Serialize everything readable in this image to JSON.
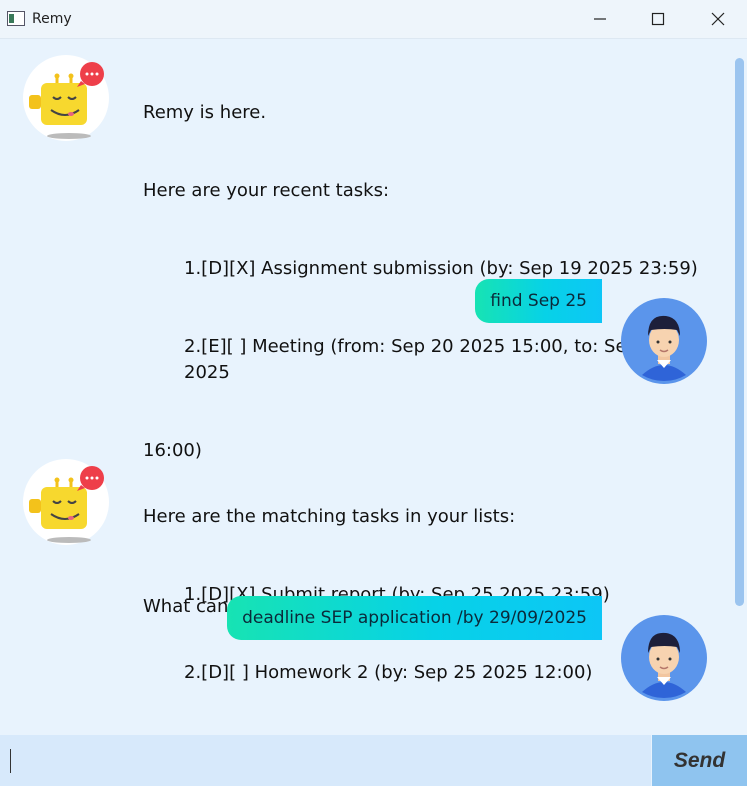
{
  "window": {
    "title": "Remy"
  },
  "messages": {
    "bot1": {
      "line1": "Remy is here.",
      "line2": "Here are your recent tasks:",
      "task1": "1.[D][X] Assignment submission (by: Sep 19 2025 23:59)",
      "task2a": "2.[E][ ] Meeting (from: Sep 20 2025 15:00, to: Sep 20 2025",
      "task2b": "16:00)",
      "line5": "What can I do for you?"
    },
    "user1": "find Sep 25",
    "bot2": {
      "line1": "Here are the matching tasks in your lists:",
      "task1": "1.[D][X] Submit report (by: Sep 25 2025 23:59)",
      "task2": "2.[D][ ] Homework 2 (by: Sep 25 2025 12:00)"
    },
    "user2": "deadline SEP application /by 29/09/2025"
  },
  "input": {
    "value": "",
    "send_label": "Send"
  }
}
